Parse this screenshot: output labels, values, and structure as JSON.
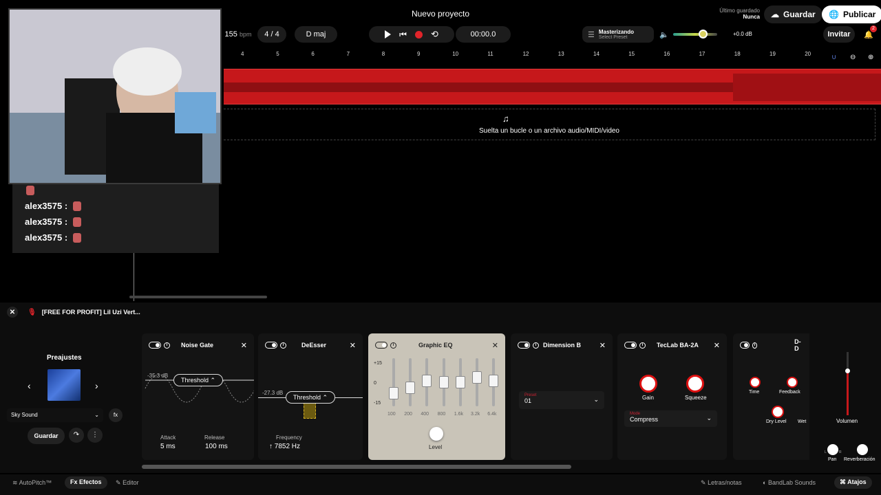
{
  "header": {
    "project_title": "Nuevo proyecto",
    "bpm_value": "155",
    "bpm_unit": "bpm",
    "time_signature": "4 / 4",
    "key": "D maj",
    "time": "00:00.0",
    "mastering_title": "Masterizando",
    "mastering_preset": "Select Preset",
    "volume_db": "+0.0 dB",
    "last_saved_label": "Último guardado",
    "last_saved_value": "Nunca",
    "save_label": "Guardar",
    "publish_label": "Publicar",
    "invite_label": "Invitar",
    "notification_count": "2"
  },
  "ruler": [
    "4",
    "5",
    "6",
    "7",
    "8",
    "9",
    "10",
    "11",
    "12",
    "13",
    "14",
    "15",
    "16",
    "17",
    "18",
    "19",
    "20"
  ],
  "drop_zone": {
    "text": "Suelta un bucle o un archivo audio/MIDI/video"
  },
  "chat": [
    {
      "user": "alex3575 :"
    },
    {
      "user": "alex3575 :"
    },
    {
      "user": "alex3575 :"
    }
  ],
  "fx_header": {
    "track_name": "[FREE FOR PROFIT] Lil Uzi Vert..."
  },
  "presets": {
    "title": "Preajustes",
    "selected": "Sky Sound",
    "save_label": "Guardar"
  },
  "effects": {
    "noise_gate": {
      "name": "Noise Gate",
      "threshold_label": "Threshold",
      "threshold_db": "-35.3 dB",
      "attack_label": "Attack",
      "attack_value": "5 ms",
      "release_label": "Release",
      "release_value": "100 ms"
    },
    "deesser": {
      "name": "DeEsser",
      "threshold_label": "Threshold",
      "threshold_db": "-27.3 dB",
      "frequency_label": "Frequency",
      "frequency_value": "7852 Hz"
    },
    "graphic_eq": {
      "name": "Graphic EQ",
      "scale": [
        "+15",
        "0",
        "-15"
      ],
      "bands": [
        "100",
        "200",
        "400",
        "800",
        "1.6k",
        "3.2k",
        "6.4k"
      ],
      "level_label": "Level"
    },
    "dimension_b": {
      "name": "Dimension B",
      "preset_label": "Preset",
      "preset_value": "01"
    },
    "teclab": {
      "name": "TecLab BA-2A",
      "gain_label": "Gain",
      "squeeze_label": "Squeeze",
      "mode_label": "Mode",
      "mode_value": "Compress"
    },
    "delay": {
      "name": "D-D",
      "time_label": "Time",
      "feedback_label": "Feedback",
      "dry_label": "Dry Level",
      "wet_label": "Wet"
    }
  },
  "mixer": {
    "volume_label": "Volumen",
    "pan_label": "Pan",
    "pan_l": "L",
    "pan_r": "R",
    "reverb_label": "Reverberación"
  },
  "bottom": {
    "autopitch": "AutoPitch™",
    "effects": "Efectos",
    "editor": "Editor",
    "lyrics": "Letras/notas",
    "sounds": "BandLab Sounds",
    "shortcuts": "Atajos"
  },
  "colors": {
    "accent_red": "#c6181b",
    "record_red": "#e0242a"
  }
}
